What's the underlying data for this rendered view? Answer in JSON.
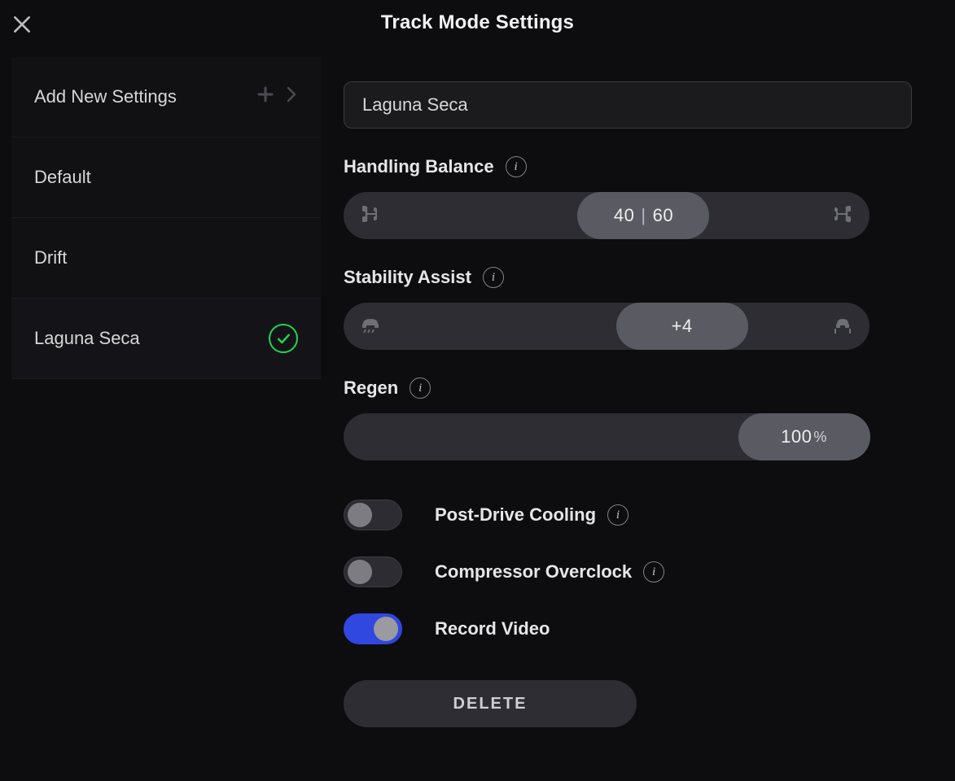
{
  "title": "Track Mode Settings",
  "sidebar": {
    "add_label": "Add New Settings",
    "items": [
      {
        "label": "Default",
        "active": false
      },
      {
        "label": "Drift",
        "active": false
      },
      {
        "label": "Laguna Seca",
        "active": true
      }
    ]
  },
  "profile_name": "Laguna Seca",
  "handling": {
    "label": "Handling Balance",
    "front": "40",
    "rear": "60",
    "position_pct": 44.5
  },
  "stability": {
    "label": "Stability Assist",
    "value": "+4",
    "position_pct": 51.8
  },
  "regen": {
    "label": "Regen",
    "value": "100",
    "unit": "%",
    "position_pct": 75
  },
  "toggles": {
    "cooling": {
      "label": "Post-Drive Cooling",
      "on": false,
      "info": true
    },
    "overclock": {
      "label": "Compressor Overclock",
      "on": false,
      "info": true
    },
    "record": {
      "label": "Record Video",
      "on": true,
      "info": false
    }
  },
  "delete_label": "DELETE"
}
